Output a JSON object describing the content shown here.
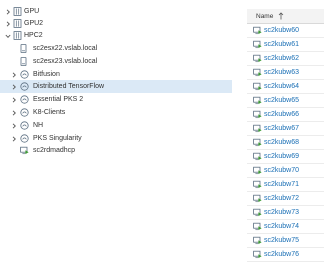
{
  "tree": {
    "items": [
      {
        "label": "GPU",
        "icon": "datacenter-icon",
        "expander": "collapsed"
      },
      {
        "label": "GPU2",
        "icon": "datacenter-icon",
        "expander": "collapsed"
      },
      {
        "label": "HPC2",
        "icon": "datacenter-icon",
        "expander": "expanded"
      },
      {
        "label": "sc2esx22.vslab.local",
        "icon": "host-icon",
        "expander": "none"
      },
      {
        "label": "sc2esx23.vslab.local",
        "icon": "host-icon",
        "expander": "none"
      },
      {
        "label": "Bitfusion",
        "icon": "resource-pool-icon",
        "expander": "collapsed"
      },
      {
        "label": "Distributed TensorFlow",
        "icon": "resource-pool-icon",
        "expander": "collapsed",
        "selected": true
      },
      {
        "label": "Essential PKS 2",
        "icon": "resource-pool-icon",
        "expander": "collapsed"
      },
      {
        "label": "K8-Clients",
        "icon": "resource-pool-icon",
        "expander": "collapsed"
      },
      {
        "label": "NH",
        "icon": "resource-pool-icon",
        "expander": "collapsed"
      },
      {
        "label": "PKS Singularity",
        "icon": "resource-pool-icon",
        "expander": "collapsed"
      },
      {
        "label": "sc2rdmadhcp",
        "icon": "vm-icon",
        "expander": "none"
      }
    ]
  },
  "vm_list": {
    "header": {
      "label": "Name",
      "sort": "ascending"
    },
    "rows": [
      "sc2kubw60",
      "sc2kubw61",
      "sc2kubw62",
      "sc2kubw63",
      "sc2kubw64",
      "sc2kubw65",
      "sc2kubw66",
      "sc2kubw67",
      "sc2kubw68",
      "sc2kubw69",
      "sc2kubw70",
      "sc2kubw71",
      "sc2kubw72",
      "sc2kubw73",
      "sc2kubw74",
      "sc2kubw75",
      "sc2kubw76"
    ]
  },
  "colors": {
    "link": "#1a6fb5",
    "selected_row": "#dbe9f6",
    "vm_icon_green": "#3f9c35"
  }
}
